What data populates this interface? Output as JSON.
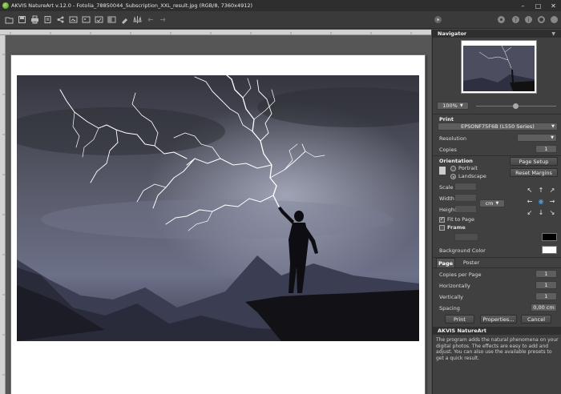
{
  "titlebar": {
    "title": "AKVIS NatureArt v.12.0 - Fotolia_78850044_Subscription_XXL_result.jpg (RGB/8, 7360x4912)",
    "controls": [
      "–",
      "□",
      "✕"
    ]
  },
  "toolbar": {
    "icons": [
      "open-icon",
      "save-icon",
      "print-icon",
      "export-icon",
      "share-icon",
      "batch-icon",
      "preset-icon",
      "plugin-icon",
      "before-after-icon",
      "undo-icon",
      "redo-icon",
      "run-icon",
      "help-icon",
      "info-icon",
      "settings-icon"
    ]
  },
  "navigator": {
    "header": "Navigator",
    "zoom": "100%"
  },
  "print": {
    "section_label": "Print",
    "printer": "EPSONF75F6B (L550 Series)",
    "resolution_label": "Resolution",
    "resolution_value": "",
    "copies_label": "Copies",
    "copies_value": "1",
    "orientation_label": "Orientation",
    "portrait_label": "Portrait",
    "landscape_label": "Landscape",
    "page_setup_button": "Page Setup",
    "reset_margins_button": "Reset Margins",
    "scale_label": "Scale",
    "width_label": "Width",
    "height_label": "Height",
    "unit": "cm",
    "fit_to_page_label": "Fit to Page",
    "frame_label": "Frame",
    "background_color_label": "Background Color",
    "frame_color": "#000000",
    "background_color": "#ffffff"
  },
  "page_tabs": {
    "page": "Page",
    "poster": "Poster",
    "copies_per_page_label": "Copies per Page",
    "copies_per_page_value": "1",
    "horizontally_label": "Horizontally",
    "horizontally_value": "1",
    "vertically_label": "Vertically",
    "vertically_value": "1",
    "spacing_label": "Spacing",
    "spacing_value": "0,00 cm"
  },
  "actions": {
    "print": "Print",
    "properties": "Properties...",
    "cancel": "Cancel"
  },
  "about": {
    "header": "AKVIS NatureArt",
    "text": "The program adds the natural phenomena on your digital photos. The effects are easy to add and adjust. You can also use the available presets to get a quick result."
  },
  "colors": {
    "accent": "#4a9bd8",
    "sky_top": "#4a4c5a",
    "lightning": "#ffffff"
  }
}
